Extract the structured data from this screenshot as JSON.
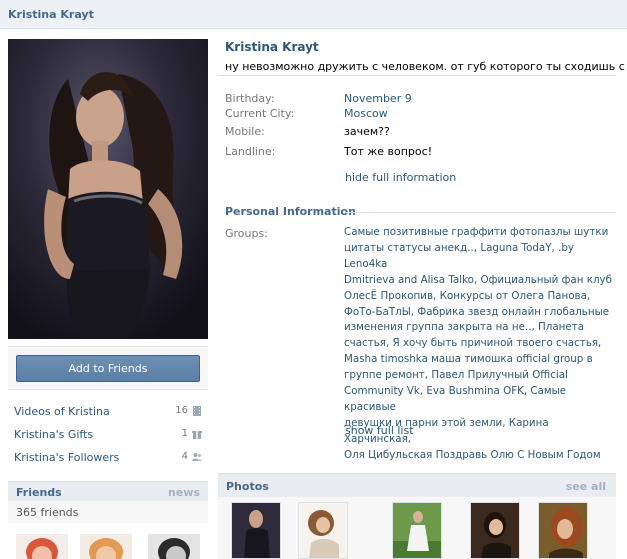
{
  "topbar": {
    "name": "Kristina Krayt"
  },
  "sidebar": {
    "add_friend_label": "Add to Friends",
    "items": [
      {
        "label": "Videos of Kristina",
        "count": "16",
        "icon": "video-icon"
      },
      {
        "label": "Kristina's Gifts",
        "count": "1",
        "icon": "gift-icon"
      },
      {
        "label": "Kristina's Followers",
        "count": "4",
        "icon": "followers-icon"
      }
    ],
    "friends": {
      "title": "Friends",
      "link": "news",
      "count": "365 friends"
    }
  },
  "profile": {
    "name": "Kristina Krayt",
    "status": "ну невозможно дружить с человеком. от губ которого ты сходишь с ума",
    "info": [
      {
        "key": "Birthday:",
        "value": "November 9",
        "link": true
      },
      {
        "key": "Current City:",
        "value": "Moscow",
        "link": true
      },
      {
        "key": "Mobile:",
        "value": "зачем??",
        "link": false
      },
      {
        "key": "Landline:",
        "value": "Тот же вопрос!",
        "link": false
      }
    ],
    "hide_info": "hide full information",
    "personal_title": "Personal Information",
    "groups_key": "Groups:",
    "groups_lines": [
      "Самые позитивные граффити фотопазлы шутки",
      "цитаты статусы анекд.., Laguna TodaY, .by Leno4ka",
      "Dmitrieva and Alisa Talko, Официальный фан клуб",
      "ОлесЁ Прокопив, Конкурсы от Олега Панова,",
      "ФоТо-БаТлЫ, Фабрика звезд онлайн глобальные",
      "изменения группа закрыта на не.., Планета",
      "счастья, Я хочу быть причиной твоего счастья,",
      "Masha timoshka маша тимошка official group в",
      "группе ремонт, Павел Прилучный Official",
      "Community Vk, Eva Bushmina OFK, Самые красивые",
      "девушки и парни этой земли, Карина Харчинская,",
      "Оля Цибульская Поздравь Олю С Новым Годом"
    ],
    "show_full": "show full list"
  },
  "photos": {
    "title": "Photos",
    "link": "see all"
  },
  "colors": {
    "link": "#2b587a",
    "header": "#45688e",
    "button": "#5b7fa6"
  }
}
